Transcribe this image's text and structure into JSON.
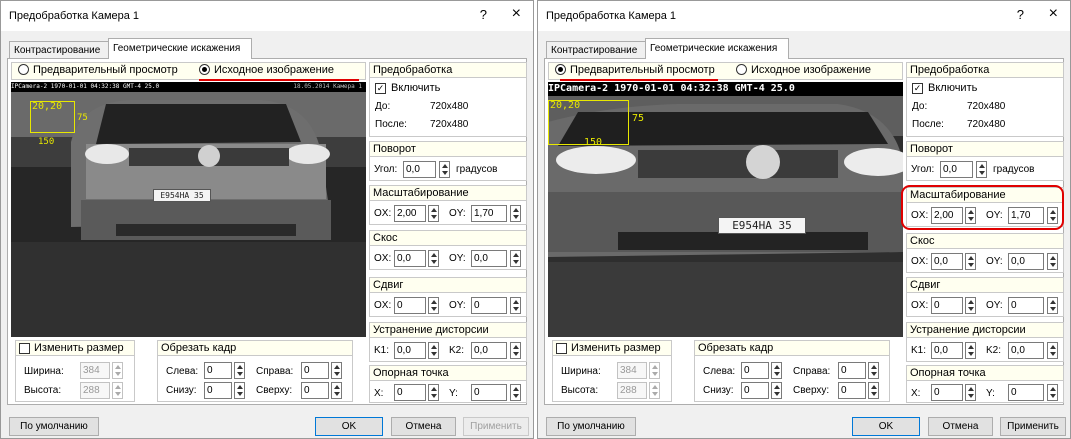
{
  "left": {
    "title": "Предобработка Камера 1",
    "help": "?",
    "close": "×",
    "tabs": [
      {
        "label": "Контрастирование"
      },
      {
        "label": "Геометрические искажения"
      }
    ],
    "radio": {
      "preview": "Предварительный просмотр",
      "source": "Исходное изображение",
      "selected": "source"
    },
    "image": {
      "osd_left": "IPCamera-2 1970-01-01 04:32:38 GMT-4 25.0",
      "osd_right": "18.05.2014  Камера 1",
      "roi_xy": "20,20",
      "roi_h": "75",
      "roi_w": "150",
      "plate": "E954HA 35"
    },
    "prep": {
      "title": "Предобработка",
      "enable": "Включить",
      "enabled": true,
      "before_label": "До:",
      "before": "720x480",
      "after_label": "После:",
      "after": "720x480"
    },
    "rotate": {
      "title": "Поворот",
      "angle_label": "Угол:",
      "angle": "0,0",
      "unit": "градусов"
    },
    "scale": {
      "title": "Масштабирование",
      "ox_label": "OX:",
      "ox": "2,00",
      "oy_label": "OY:",
      "oy": "1,70"
    },
    "skew": {
      "title": "Скос",
      "ox_label": "OX:",
      "ox": "0,0",
      "oy_label": "OY:",
      "oy": "0,0"
    },
    "shift": {
      "title": "Сдвиг",
      "ox_label": "OX:",
      "ox": "0",
      "oy_label": "OY:",
      "oy": "0"
    },
    "dist": {
      "title": "Устранение дисторсии",
      "k1_label": "K1:",
      "k1": "0,0",
      "k2_label": "K2:",
      "k2": "0,0"
    },
    "anchor": {
      "title": "Опорная точка",
      "x_label": "X:",
      "x": "0",
      "y_label": "Y:",
      "y": "0"
    },
    "resize": {
      "title": "Изменить размер",
      "checked": false,
      "width_label": "Ширина:",
      "width": "384",
      "height_label": "Высота:",
      "height": "288"
    },
    "crop": {
      "title": "Обрезать кадр",
      "left_label": "Слева:",
      "left": "0",
      "right_label": "Справа:",
      "right": "0",
      "bottom_label": "Снизу:",
      "bottom": "0",
      "top_label": "Сверху:",
      "top": "0"
    },
    "buttons": {
      "defaults": "По умолчанию",
      "ok": "OK",
      "cancel": "Отмена",
      "apply": "Применить"
    }
  },
  "right": {
    "title": "Предобработка Камера 1",
    "help": "?",
    "close": "×",
    "tabs": [
      {
        "label": "Контрастирование"
      },
      {
        "label": "Геометрические искажения"
      }
    ],
    "radio": {
      "preview": "Предварительный просмотр",
      "source": "Исходное изображение",
      "selected": "preview"
    },
    "image": {
      "osd_left": "IPCamera-2 1970-01-01 04:32:38 GMT-4  25.0",
      "roi_xy": "20,20",
      "roi_h": "75",
      "roi_w": "150",
      "plate": "E954HA 35"
    },
    "prep": {
      "title": "Предобработка",
      "enable": "Включить",
      "enabled": true,
      "before_label": "До:",
      "before": "720x480",
      "after_label": "После:",
      "after": "720x480"
    },
    "rotate": {
      "title": "Поворот",
      "angle_label": "Угол:",
      "angle": "0,0",
      "unit": "градусов"
    },
    "scale": {
      "title": "Масштабирование",
      "ox_label": "OX:",
      "ox": "2,00",
      "oy_label": "OY:",
      "oy": "1,70"
    },
    "skew": {
      "title": "Скос",
      "ox_label": "OX:",
      "ox": "0,0",
      "oy_label": "OY:",
      "oy": "0,0"
    },
    "shift": {
      "title": "Сдвиг",
      "ox_label": "OX:",
      "ox": "0",
      "oy_label": "OY:",
      "oy": "0"
    },
    "dist": {
      "title": "Устранение дисторсии",
      "k1_label": "K1:",
      "k1": "0,0",
      "k2_label": "K2:",
      "k2": "0,0"
    },
    "anchor": {
      "title": "Опорная точка",
      "x_label": "X:",
      "x": "0",
      "y_label": "Y:",
      "y": "0"
    },
    "resize": {
      "title": "Изменить размер",
      "checked": false,
      "width_label": "Ширина:",
      "width": "384",
      "height_label": "Высота:",
      "height": "288"
    },
    "crop": {
      "title": "Обрезать кадр",
      "left_label": "Слева:",
      "left": "0",
      "right_label": "Справа:",
      "right": "0",
      "bottom_label": "Снизу:",
      "bottom": "0",
      "top_label": "Сверху:",
      "top": "0"
    },
    "buttons": {
      "defaults": "По умолчанию",
      "ok": "OK",
      "cancel": "Отмена",
      "apply": "Применить"
    }
  },
  "colors": {
    "highlight": "#e00000",
    "roi": "#e8e800",
    "group_header": "#fffff0"
  }
}
